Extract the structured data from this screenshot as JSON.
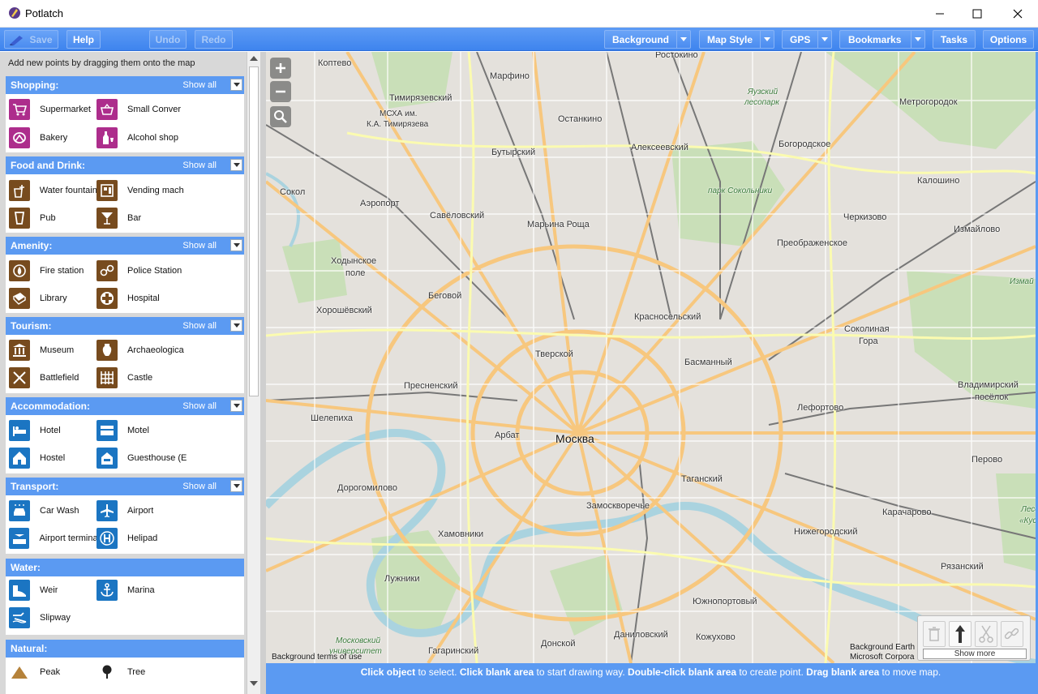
{
  "window": {
    "title": "Potlatch"
  },
  "toolbar": {
    "save": "Save",
    "help": "Help",
    "undo": "Undo",
    "redo": "Redo",
    "background": "Background",
    "map_style": "Map Style",
    "gps": "GPS",
    "bookmarks": "Bookmarks",
    "tasks": "Tasks",
    "options": "Options"
  },
  "panel": {
    "hint": "Add new points by dragging them onto the map",
    "show_all": "Show all",
    "sections": [
      {
        "title": "Shopping:",
        "items": [
          "Supermarket",
          "Small Conver",
          "Bakery",
          "Alcohol shop"
        ]
      },
      {
        "title": "Food and Drink:",
        "items": [
          "Water fountain",
          "Vending mach",
          "Pub",
          "Bar"
        ]
      },
      {
        "title": "Amenity:",
        "items": [
          "Fire station",
          "Police Station",
          "Library",
          "Hospital"
        ]
      },
      {
        "title": "Tourism:",
        "items": [
          "Museum",
          "Archaeologica",
          "Battlefield",
          "Castle"
        ]
      },
      {
        "title": "Accommodation:",
        "items": [
          "Hotel",
          "Motel",
          "Hostel",
          "Guesthouse (E"
        ]
      },
      {
        "title": "Transport:",
        "items": [
          "Car Wash",
          "Airport",
          "Airport termina",
          "Helipad"
        ]
      },
      {
        "title": "Water:",
        "items": [
          "Weir",
          "Marina",
          "Slipway"
        ]
      },
      {
        "title": "Natural:",
        "items": [
          "Peak",
          "Tree"
        ]
      }
    ]
  },
  "map": {
    "labels": {
      "center": "Москва",
      "koptevo": "Коптево",
      "marfino": "Марфино",
      "rostokino": "Ростокино",
      "timiryazevsky": "Тимирязевский",
      "mskha": "МСХА им.",
      "mskha2": "К.А. Тимирязева",
      "ostankino": "Останкино",
      "butyrsky": "Бутырский",
      "alekseevsky": "Алексеевский",
      "bogorodskoe": "Богородское",
      "metrogorodok": "Метрогородок",
      "yauzsky": "Яузский",
      "lesopark": "лесопарк",
      "sokol": "Сокол",
      "aeroport": "Аэропорт",
      "savelovsky": "Савёловский",
      "maryina_roshcha": "Марьина Роща",
      "park_sokolniki": "парк Сокольники",
      "kaloshino": "Калошино",
      "cherkizovo": "Черкизово",
      "izmaylovo": "Измайлово",
      "preobrazhenskoe": "Преображенское",
      "khodynskoe": "Ходынское",
      "pole": "поле",
      "begovoy": "Беговой",
      "khoroshevsky": "Хорошёвский",
      "krasnoselsky": "Красносельский",
      "sokolinaya": "Соколиная",
      "gora": "Гора",
      "izmayl2": "Измай",
      "tverskoy": "Тверской",
      "basmanny": "Басманный",
      "presnensky": "Пресненский",
      "vladimirsky": "Владимирский",
      "poselok": "посёлок",
      "shelepikha": "Шелепиха",
      "arbat": "Арбат",
      "lefortovo": "Лефортово",
      "dorogomilovo": "Дорогомилово",
      "taganskiy": "Таганский",
      "perovo": "Перово",
      "zamoskvorechye": "Замоскворечье",
      "karacharovo": "Карачарово",
      "khamovniki": "Хамовники",
      "nizhegorodsky": "Нижегородский",
      "luzhniki": "Лужники",
      "ryazansky": "Рязанский",
      "yuzhnoportovy": "Южнопортовый",
      "donskoy": "Донской",
      "danilovsky": "Даниловский",
      "kozhukhovo": "Кожухово",
      "gagarinsky": "Гагаринский",
      "moskovsky": "Московский",
      "universitet": "университет",
      "lesopark2": "Лесо",
      "kusk": "«Куск"
    },
    "attribution_left": "Background terms of use",
    "attribution_right1": "Background Earth",
    "attribution_right2": "Microsoft Corpora"
  },
  "tools": {
    "show_more": "Show more"
  },
  "hintbar": {
    "p1": "Click object",
    "p2": " to select. ",
    "p3": "Click blank area",
    "p4": " to start drawing way. ",
    "p5": "Double-click blank area",
    "p6": " to create point. ",
    "p7": "Drag blank area",
    "p8": " to move map."
  }
}
